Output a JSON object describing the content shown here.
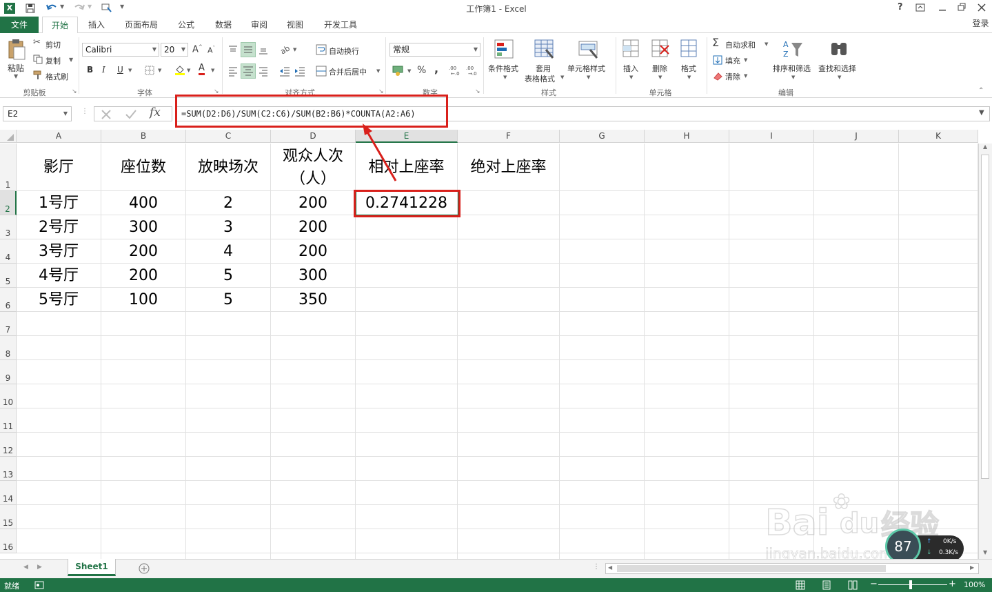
{
  "window": {
    "title": "工作簿1 - Excel",
    "help": "?",
    "login": "登录"
  },
  "tabs": [
    "文件",
    "开始",
    "插入",
    "页面布局",
    "公式",
    "数据",
    "审阅",
    "视图",
    "开发工具"
  ],
  "ribbon": {
    "clipboard": {
      "paste": "粘贴",
      "cut": "剪切",
      "copy": "复制",
      "format_painter": "格式刷",
      "label": "剪贴板"
    },
    "font": {
      "name": "Calibri",
      "size": "20",
      "bold": "B",
      "italic": "I",
      "underline": "U",
      "label": "字体"
    },
    "alignment": {
      "wrap": "自动换行",
      "merge": "合并后居中",
      "label": "对齐方式"
    },
    "number": {
      "format": "常规",
      "percent": "%",
      "comma": ",",
      "label": "数字"
    },
    "styles": {
      "conditional": "条件格式",
      "table_line1": "套用",
      "table_line2": "表格格式",
      "cell_styles": "单元格样式",
      "label": "样式"
    },
    "cells": {
      "insert": "插入",
      "delete": "删除",
      "format": "格式",
      "label": "单元格"
    },
    "editing": {
      "autosum": "自动求和",
      "fill": "填充",
      "clear": "清除",
      "sort": "排序和筛选",
      "find": "查找和选择",
      "label": "编辑"
    }
  },
  "formula_bar": {
    "name_box": "E2",
    "fx": "fx",
    "formula": "=SUM(D2:D6)/SUM(C2:C6)/SUM(B2:B6)*COUNTA(A2:A6)"
  },
  "columns": [
    "A",
    "B",
    "C",
    "D",
    "E",
    "F",
    "G",
    "H",
    "I",
    "J",
    "K"
  ],
  "rows": [
    "1",
    "2",
    "3",
    "4",
    "5",
    "6",
    "7",
    "8",
    "9",
    "10",
    "11",
    "12",
    "13",
    "14",
    "15",
    "16"
  ],
  "cells": {
    "header": [
      "影厅",
      "座位数",
      "放映场次",
      "观众人次",
      "（人）",
      "相对上座率",
      "绝对上座率"
    ],
    "r2": [
      "1号厅",
      "400",
      "2",
      "200",
      "0.2741228"
    ],
    "r3": [
      "2号厅",
      "300",
      "3",
      "200"
    ],
    "r4": [
      "3号厅",
      "200",
      "4",
      "200"
    ],
    "r5": [
      "4号厅",
      "200",
      "5",
      "300"
    ],
    "r6": [
      "5号厅",
      "100",
      "5",
      "350"
    ]
  },
  "sheet_tab": "Sheet1",
  "status": {
    "ready": "就绪",
    "zoom": "100%"
  },
  "overlay": {
    "speed_percent": "87",
    "up": "0K/s",
    "down": "0.3K/s",
    "watermark1": "Bai",
    "watermark2": "du",
    "watermark3": "经验",
    "watermark_url": "jingyan.baidu.com"
  },
  "colors": {
    "excel_green": "#217346",
    "highlight_red": "#d9201b"
  }
}
